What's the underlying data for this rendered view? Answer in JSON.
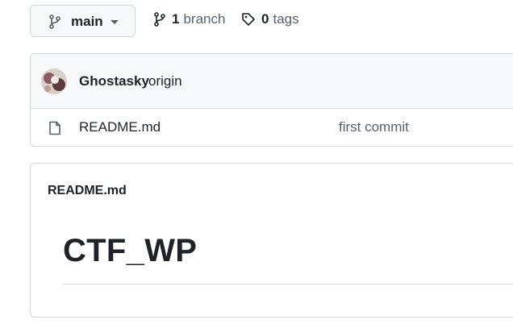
{
  "branch_selector": {
    "label": "main",
    "icon": "git-branch-icon"
  },
  "branches": {
    "count": "1",
    "label": "branch",
    "icon": "git-branch-icon"
  },
  "tags": {
    "count": "0",
    "label": "tags",
    "icon": "tag-icon"
  },
  "latest_commit": {
    "author": "Ghostasky",
    "message": "origin"
  },
  "files": [
    {
      "name": "README.md",
      "commit_message": "first commit",
      "icon": "file-icon"
    }
  ],
  "readme": {
    "title": "README.md",
    "heading": "CTF_WP"
  },
  "colors": {
    "border": "#d0d7de",
    "header_bg": "#f6f8fa",
    "text": "#1f2328",
    "muted": "#57606a"
  }
}
